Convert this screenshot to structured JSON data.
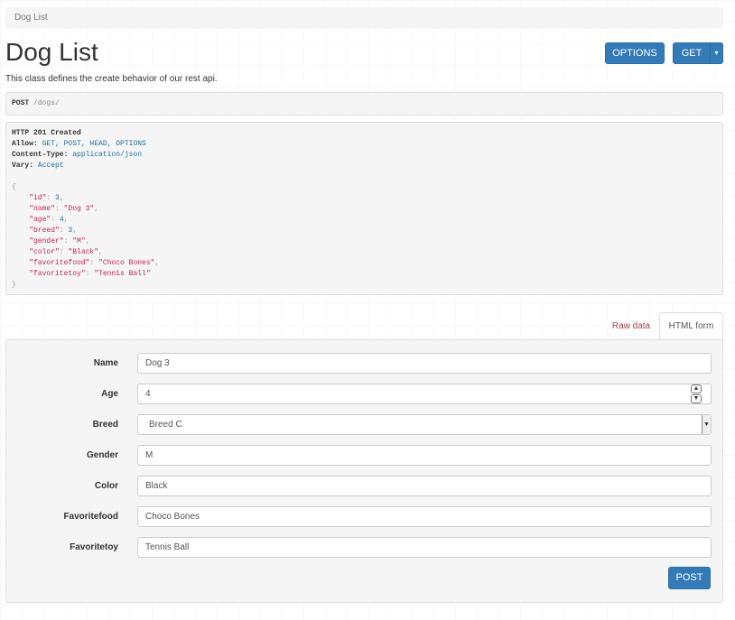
{
  "breadcrumb": {
    "items": [
      "Dog List"
    ]
  },
  "header": {
    "title": "Dog List",
    "description": "This class defines the create behavior of our rest api.",
    "options_label": "OPTIONS",
    "get_label": "GET",
    "get_caret": "▾"
  },
  "request": {
    "method": "POST",
    "path": "/dogs/"
  },
  "response": {
    "status": "HTTP 201 Created",
    "headers": [
      {
        "key": "Allow:",
        "value": "GET, POST, HEAD, OPTIONS"
      },
      {
        "key": "Content-Type:",
        "value": "application/json"
      },
      {
        "key": "Vary:",
        "value": "Accept"
      }
    ],
    "open_brace": "{",
    "close_brace": "}",
    "body": [
      {
        "key": "\"id\"",
        "value": "3",
        "comma": ","
      },
      {
        "key": "\"name\"",
        "value": "\"Dog 3\"",
        "comma": ","
      },
      {
        "key": "\"age\"",
        "value": "4",
        "comma": ","
      },
      {
        "key": "\"breed\"",
        "value": "3",
        "comma": ","
      },
      {
        "key": "\"gender\"",
        "value": "\"M\"",
        "comma": ","
      },
      {
        "key": "\"color\"",
        "value": "\"Black\"",
        "comma": ","
      },
      {
        "key": "\"favoritefood\"",
        "value": "\"Choco Bones\"",
        "comma": ","
      },
      {
        "key": "\"favoritetoy\"",
        "value": "\"Tennis Ball\"",
        "comma": ""
      }
    ]
  },
  "tabs": {
    "raw_label": "Raw data",
    "html_label": "HTML form"
  },
  "form": {
    "fields": [
      {
        "label": "Name",
        "value": "Dog 3"
      },
      {
        "label": "Age",
        "value": "4"
      },
      {
        "label": "Breed",
        "value": "Breed C"
      },
      {
        "label": "Gender",
        "value": "M"
      },
      {
        "label": "Color",
        "value": "Black"
      },
      {
        "label": "Favoritefood",
        "value": "Choco Bones"
      },
      {
        "label": "Favoritetoy",
        "value": "Tennis Ball"
      }
    ],
    "submit_label": "POST"
  },
  "colors": {
    "primary": "#337ab7",
    "link_red": "#a94442",
    "json_key": "#c7254e",
    "json_value": "#1f6fa0"
  }
}
